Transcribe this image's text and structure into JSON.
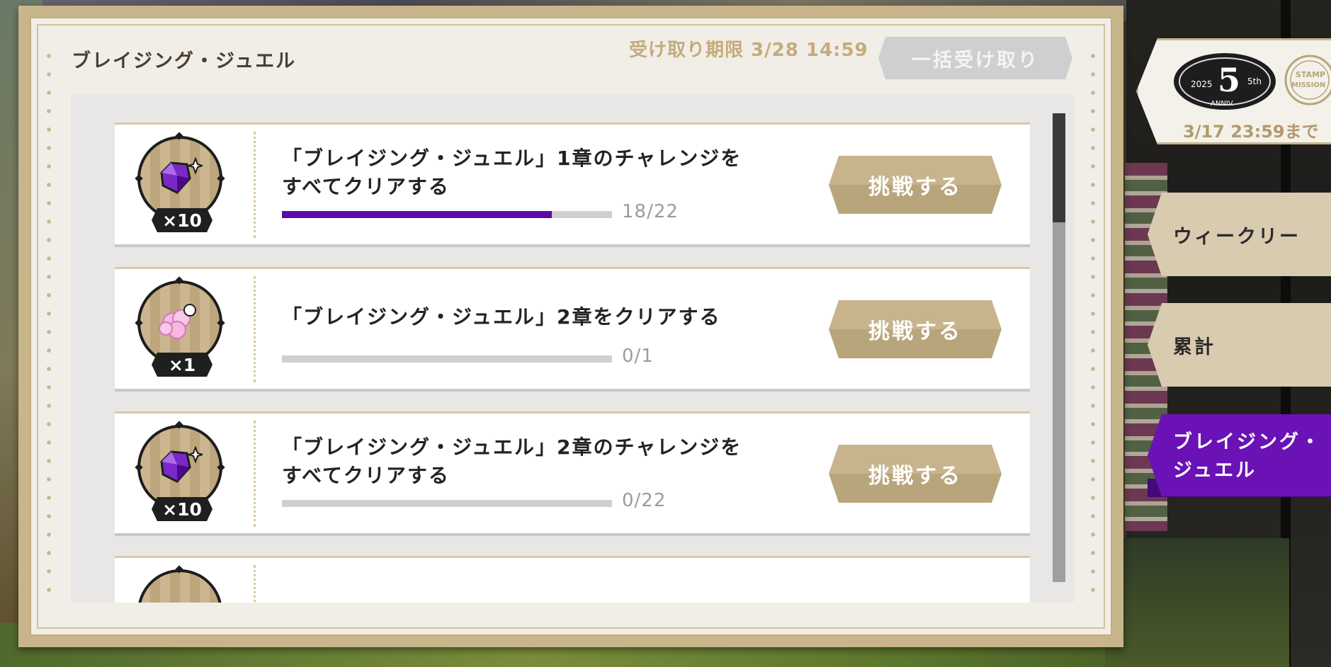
{
  "panel": {
    "title": "ブレイジング・ジュエル",
    "deadline": "受け取り期限 3/28 14:59",
    "claim_all_label": "一括受け取り"
  },
  "missions": [
    {
      "text_line1": "「ブレイジング・ジュエル」1章のチャレンジを",
      "text_line2": "すべてクリアする",
      "reward_icon": "purple-gem-icon",
      "reward_qty": "×10",
      "progress": 0.818,
      "count": "18/22",
      "button_label": "挑戦する"
    },
    {
      "text_line1": "「ブレイジング・ジュエル」2章をクリアする",
      "text_line2": "",
      "reward_icon": "pink-cloud-icon",
      "reward_qty": "×1",
      "progress": 0,
      "count": "0/1",
      "button_label": "挑戦する"
    },
    {
      "text_line1": "「ブレイジング・ジュエル」2章のチャレンジを",
      "text_line2": "すべてクリアする",
      "reward_icon": "purple-gem-icon",
      "reward_qty": "×10",
      "progress": 0,
      "count": "0/22",
      "button_label": "挑戦する"
    }
  ],
  "side": {
    "stamp_date": "3/17 23:59まで",
    "stamp_logo_text": [
      "2025",
      "5",
      "5th",
      "ANNIV.",
      "STAMP",
      "MISSION"
    ],
    "tabs": [
      {
        "label": "ウィークリー",
        "active": false
      },
      {
        "label": "累計",
        "active": false
      },
      {
        "label": "ブレイジング・ジュエル",
        "active": true
      }
    ]
  },
  "colors": {
    "accent_purple": "#6a12b5",
    "progress_fill": "#5e0aa8",
    "button_gold": "#c8b48c",
    "frame_gold": "#c9b58c"
  }
}
